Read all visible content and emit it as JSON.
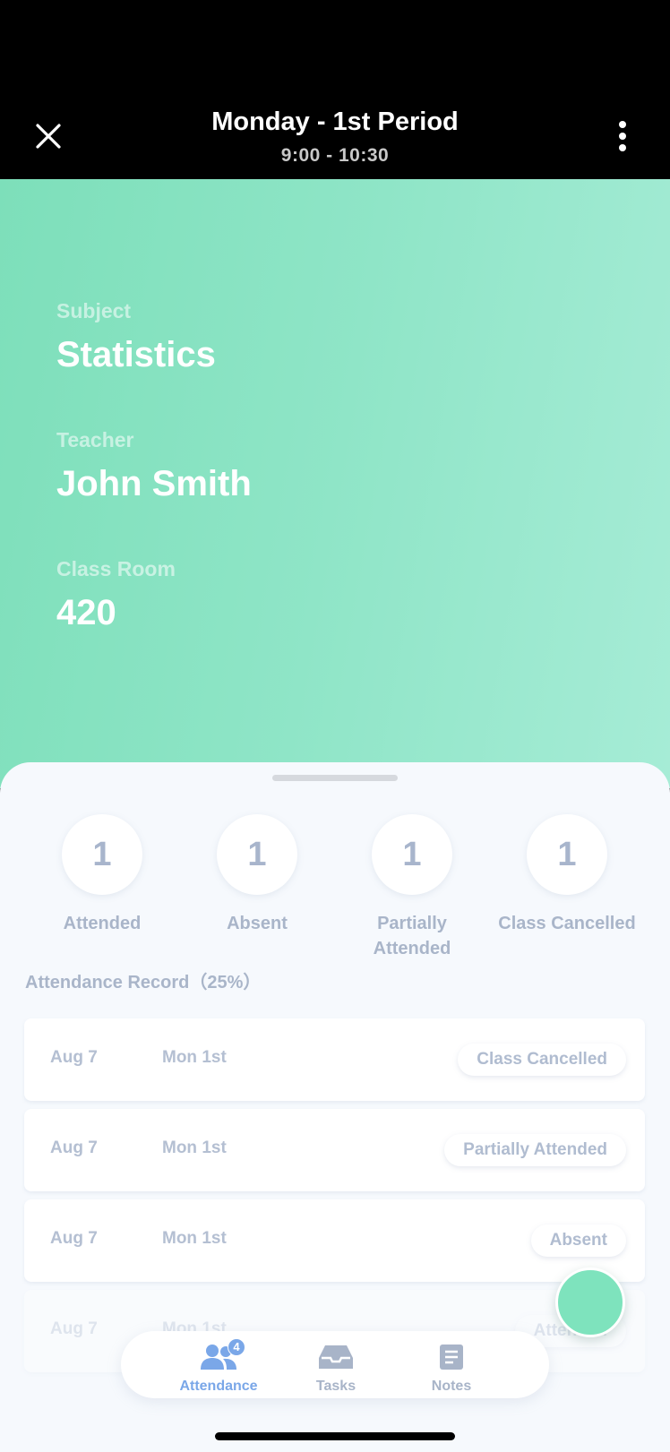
{
  "header": {
    "title": "Monday - 1st Period",
    "time": "9:00 - 10:30"
  },
  "details": {
    "subject_label": "Subject",
    "subject": "Statistics",
    "teacher_label": "Teacher",
    "teacher": "John Smith",
    "room_label": "Class Room",
    "room": "420"
  },
  "stats": [
    {
      "count": "1",
      "label": "Attended"
    },
    {
      "count": "1",
      "label": "Absent"
    },
    {
      "count": "1",
      "label": "Partially Attended"
    },
    {
      "count": "1",
      "label": "Class Cancelled"
    }
  ],
  "attendance": {
    "title": "Attendance Record（25%）",
    "records": [
      {
        "date": "Aug 7",
        "period": "Mon 1st",
        "status": "Class Cancelled"
      },
      {
        "date": "Aug 7",
        "period": "Mon 1st",
        "status": "Partially Attended"
      },
      {
        "date": "Aug 7",
        "period": "Mon 1st",
        "status": "Absent"
      },
      {
        "date": "Aug 7",
        "period": "Mon 1st",
        "status": "Attended"
      }
    ]
  },
  "tabs": [
    {
      "label": "Attendance",
      "icon": "people-icon",
      "badge": "4",
      "active": true
    },
    {
      "label": "Tasks",
      "icon": "inbox-icon"
    },
    {
      "label": "Notes",
      "icon": "notes-icon"
    }
  ],
  "colors": {
    "accent_green": "#7ddfba",
    "tab_active": "#7aa7e8",
    "muted_text": "#a9b5c9"
  }
}
